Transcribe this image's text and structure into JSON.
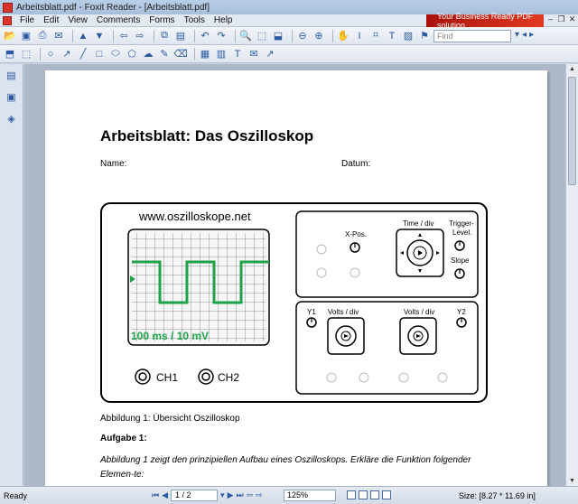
{
  "window": {
    "title": "Arbeitsblatt.pdf - Foxit Reader - [Arbeitsblatt.pdf]"
  },
  "menu": {
    "items": [
      "File",
      "Edit",
      "View",
      "Comments",
      "Forms",
      "Tools",
      "Help"
    ],
    "ad_text": "Your Business Ready PDF solution"
  },
  "toolbar": {
    "find_placeholder": "Find"
  },
  "document": {
    "heading": "Arbeitsblatt: Das Oszilloskop",
    "name_label": "Name:",
    "date_label": "Datum:",
    "figure": {
      "url": "www.oszilloskope.net",
      "timebase_text": "100 ms / 10 mV",
      "ch1": "CH1",
      "ch2": "CH2",
      "xpos": "X-Pos.",
      "time_div": "Time / div",
      "trigger_line1": "Trigger-",
      "trigger_line2": "Level.",
      "slope": "Slope",
      "y1": "Y1",
      "y2": "Y2",
      "volts_div_left": "Volts / div",
      "volts_div_right": "Volts / div"
    },
    "caption": "Abbildung 1: Übersicht Oszilloskop",
    "task_title": "Aufgabe 1:",
    "task_text": "Abbildung 1 zeigt den prinzipiellen Aufbau eines Oszilloskops. Erkläre die Funktion folgender Elemen-te:"
  },
  "status": {
    "text": "Ready",
    "page": "1 / 2",
    "zoom": "125%",
    "size": "Size: [8.27 * 11.69 in]"
  },
  "colors": {
    "trace": "#1fa24a",
    "accent": "#2c5aa0"
  }
}
